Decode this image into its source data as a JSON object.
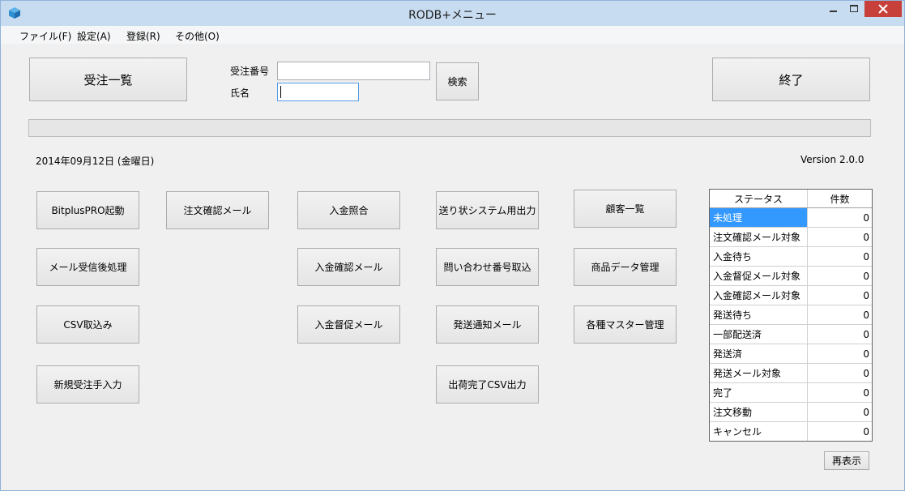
{
  "window": {
    "title": "RODB+メニュー"
  },
  "menu": [
    "ファイル(F)",
    "設定(A)",
    "登録(R)",
    "その他(O)"
  ],
  "top": {
    "order_list_button": "受注一覧",
    "order_number_label": "受注番号",
    "order_number_value": "",
    "name_label": "氏名",
    "name_value": "",
    "search_button": "検索",
    "exit_button": "終了"
  },
  "info": {
    "date": "2014年09月12日 (金曜日)",
    "version": "Version 2.0.0"
  },
  "buttons": {
    "bitplus_start": "BitplusPRO起動",
    "order_confirm_mail": "注文確認メール",
    "payment_match": "入金照合",
    "shipping_system_output": "送り状システム用出力",
    "customer_list": "顧客一覧",
    "mail_receive_process": "メール受信後処理",
    "payment_confirm_mail": "入金確認メール",
    "inquiry_number_import": "問い合わせ番号取込",
    "product_data_manage": "商品データ管理",
    "csv_import": "CSV取込み",
    "payment_reminder_mail": "入金督促メール",
    "shipping_notice_mail": "発送通知メール",
    "master_manage": "各種マスター管理",
    "new_order_manual": "新規受注手入力",
    "shipment_complete_csv": "出荷完了CSV出力"
  },
  "status_table": {
    "headers": [
      "ステータス",
      "件数"
    ],
    "rows": [
      {
        "status": "未処理",
        "count": "0"
      },
      {
        "status": "注文確認メール対象",
        "count": "0"
      },
      {
        "status": "入金待ち",
        "count": "0"
      },
      {
        "status": "入金督促メール対象",
        "count": "0"
      },
      {
        "status": "入金確認メール対象",
        "count": "0"
      },
      {
        "status": "発送待ち",
        "count": "0"
      },
      {
        "status": "一部配送済",
        "count": "0"
      },
      {
        "status": "発送済",
        "count": "0"
      },
      {
        "status": "発送メール対象",
        "count": "0"
      },
      {
        "status": "完了",
        "count": "0"
      },
      {
        "status": "注文移動",
        "count": "0"
      },
      {
        "status": "キャンセル",
        "count": "0"
      }
    ],
    "refresh_button": "再表示"
  }
}
